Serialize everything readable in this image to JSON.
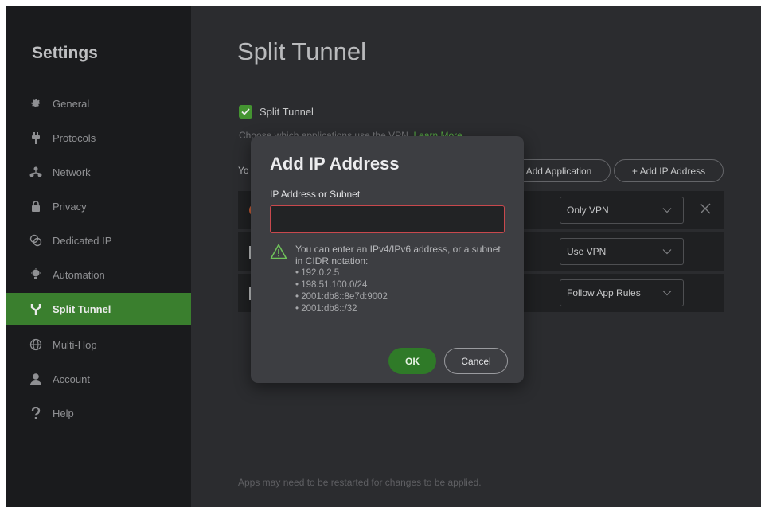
{
  "sidebar": {
    "title": "Settings",
    "items": [
      {
        "label": "General",
        "icon": "gear-icon"
      },
      {
        "label": "Protocols",
        "icon": "plug-icon"
      },
      {
        "label": "Network",
        "icon": "network-icon"
      },
      {
        "label": "Privacy",
        "icon": "lock-icon"
      },
      {
        "label": "Dedicated IP",
        "icon": "dedicated-ip-icon"
      },
      {
        "label": "Automation",
        "icon": "lightbulb-icon"
      },
      {
        "label": "Split Tunnel",
        "icon": "split-tunnel-icon",
        "active": true
      },
      {
        "label": "Multi-Hop",
        "icon": "globe-icon"
      },
      {
        "label": "Account",
        "icon": "user-icon"
      },
      {
        "label": "Help",
        "icon": "question-icon"
      }
    ]
  },
  "main": {
    "title": "Split Tunnel",
    "split_tunnel_checkbox": {
      "label": "Split Tunnel",
      "checked": true
    },
    "description": "Choose which applications use the VPN.",
    "learn_more": "Learn More",
    "your_apps_label": "Yo",
    "add_application_label": "Add Application",
    "add_ip_label": "+ Add IP Address",
    "rows": [
      {
        "rule": "Only VPN"
      },
      {
        "rule": "Use VPN"
      },
      {
        "rule": "Follow App Rules"
      }
    ],
    "footer_note": "Apps may need to be restarted for changes to be applied."
  },
  "dialog": {
    "title": "Add IP Address",
    "field_label": "IP Address or Subnet",
    "field_value": "",
    "hint": "You can enter an IPv4/IPv6 address, or a subnet in CIDR notation:",
    "examples": [
      "• 192.0.2.5",
      "• 198.51.100.0/24",
      "• 2001:db8::8e7d:9002",
      "• 2001:db8::/32"
    ],
    "ok_label": "OK",
    "cancel_label": "Cancel"
  },
  "colors": {
    "accent_green": "#3f8a32",
    "sidebar_bg": "#1d1e20",
    "main_bg": "#2f3033",
    "dialog_bg": "#3d3e42",
    "input_error_border": "#c8484d"
  }
}
